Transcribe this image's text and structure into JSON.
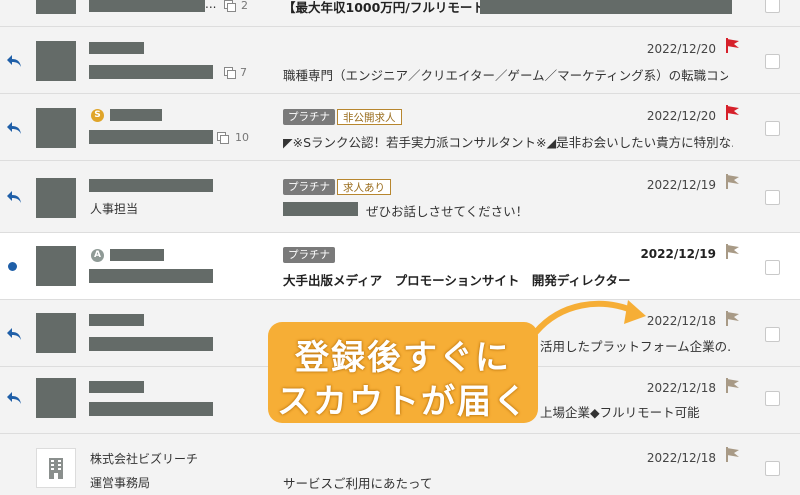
{
  "colors": {
    "accent_orange": "#f6ae36",
    "flag_red": "#d6202a",
    "flag_gray": "#a89a86",
    "unread_blue": "#1f5fa8",
    "redaction": "#646b68"
  },
  "rows": [
    {
      "thread_count": "2",
      "subject": "【最大年収1000万円/フルリモート】",
      "sender_suffix": "..."
    },
    {
      "thread_count": "7",
      "subject": "職種専門（エンジニア／クリエイター／ゲーム／マーケティング系）の転職コン...",
      "date": "2022/12/20",
      "flag": "red"
    },
    {
      "thread_count": "10",
      "badge": "S",
      "tags": [
        "プラチナ",
        "非公開求人"
      ],
      "subject": "◤※Sランク公認！若手実力派コンサルタント※◢是非お会いしたい貴方に特別な...",
      "date": "2022/12/20",
      "flag": "red"
    },
    {
      "sender_line2": "人事担当",
      "tags": [
        "プラチナ",
        "求人あり"
      ],
      "subject": "ぜひお話しさせてください！",
      "date": "2022/12/19",
      "flag": "gray"
    },
    {
      "badge": "A",
      "tags": [
        "プラチナ"
      ],
      "subject": "大手出版メディア　プロモーションサイト　開発ディレクター",
      "date": "2022/12/19",
      "flag": "gray"
    },
    {
      "subject": "活用したプラットフォーム企業の...",
      "date": "2022/12/18",
      "flag": "gray"
    },
    {
      "subject": "上場企業◆フルリモート可能",
      "date": "2022/12/18",
      "flag": "gray"
    },
    {
      "sender_name": "株式会社ビズリーチ",
      "sender_line2": "運営事務局",
      "subject": "サービスご利用にあたって",
      "date": "2022/12/18",
      "flag": "gray"
    }
  ],
  "callout": {
    "line1": "登録後すぐに",
    "line2": "スカウトが届く"
  }
}
